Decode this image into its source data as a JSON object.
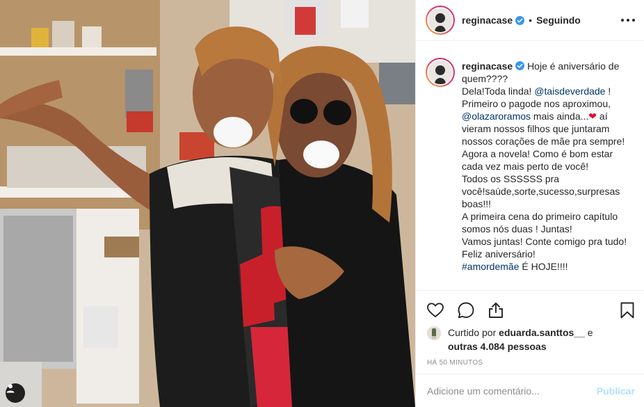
{
  "post": {
    "username": "reginacase",
    "separator": "•",
    "follow_status": "Seguindo",
    "caption": {
      "lines": [
        "Hoje é aniversário de",
        "quem????",
        "Dela!Toda linda!",
        "@taisdeverdade",
        "!",
        "Primeiro o pagode nos aproximou,",
        "@olazaroramos",
        "mais ainda...",
        "❤",
        "aí",
        "vieram nossos filhos que juntaram",
        "nossos corações de mãe pra sempre!",
        "Agora a novela! Como é bom estar",
        "cada vez mais perto de você!",
        "Todos os SSSSSS pra",
        "você!saúde,sorte,sucesso,surpresas",
        "boas!!!",
        "A primeira cena do primeiro capítulo",
        "somos nós duas ! Juntas!",
        "Vamos juntas! Conte comigo pra tudo!",
        "Feliz aniversário!",
        "#amordemãe",
        "É HOJE!!!!"
      ]
    },
    "likes": {
      "prefix": "Curtido por",
      "user": "eduarda.santtos__",
      "conj": "e",
      "others": "outras 4.084 pessoas"
    },
    "timestamp": "HÁ 50 MINUTOS",
    "comment": {
      "placeholder": "Adicione um comentário...",
      "publish_label": "Publicar"
    }
  },
  "colors": {
    "verified": "#3897f0",
    "mention": "#003569",
    "heart": "#e0102b",
    "publish_disabled": "#b2dffc"
  },
  "icons": [
    "heart-icon",
    "comment-icon",
    "share-icon",
    "bookmark-icon",
    "more-options-icon",
    "verified-badge-icon",
    "user-tag-icon"
  ]
}
